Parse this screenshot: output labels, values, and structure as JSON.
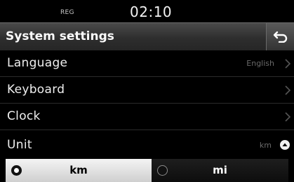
{
  "status": {
    "mode": "REG",
    "time": "02:10"
  },
  "header": {
    "title": "System settings"
  },
  "menu": {
    "items": [
      {
        "label": "Language",
        "value": "English"
      },
      {
        "label": "Keyboard",
        "value": ""
      },
      {
        "label": "Clock",
        "value": ""
      },
      {
        "label": "Unit",
        "value": "km"
      }
    ]
  },
  "unit_options": {
    "options": [
      {
        "label": "km",
        "selected": true
      },
      {
        "label": "mi",
        "selected": false
      }
    ]
  },
  "colors": {
    "background": "#000000",
    "selected_option": "#e6e6e6",
    "title_bar": "#3a3a3a"
  },
  "icons": {
    "back": "back-arrow-icon",
    "chevron": "chevron-right-icon",
    "collapse": "caret-up-icon",
    "radio_on": "radio-selected-icon",
    "radio_off": "radio-unselected-icon"
  }
}
